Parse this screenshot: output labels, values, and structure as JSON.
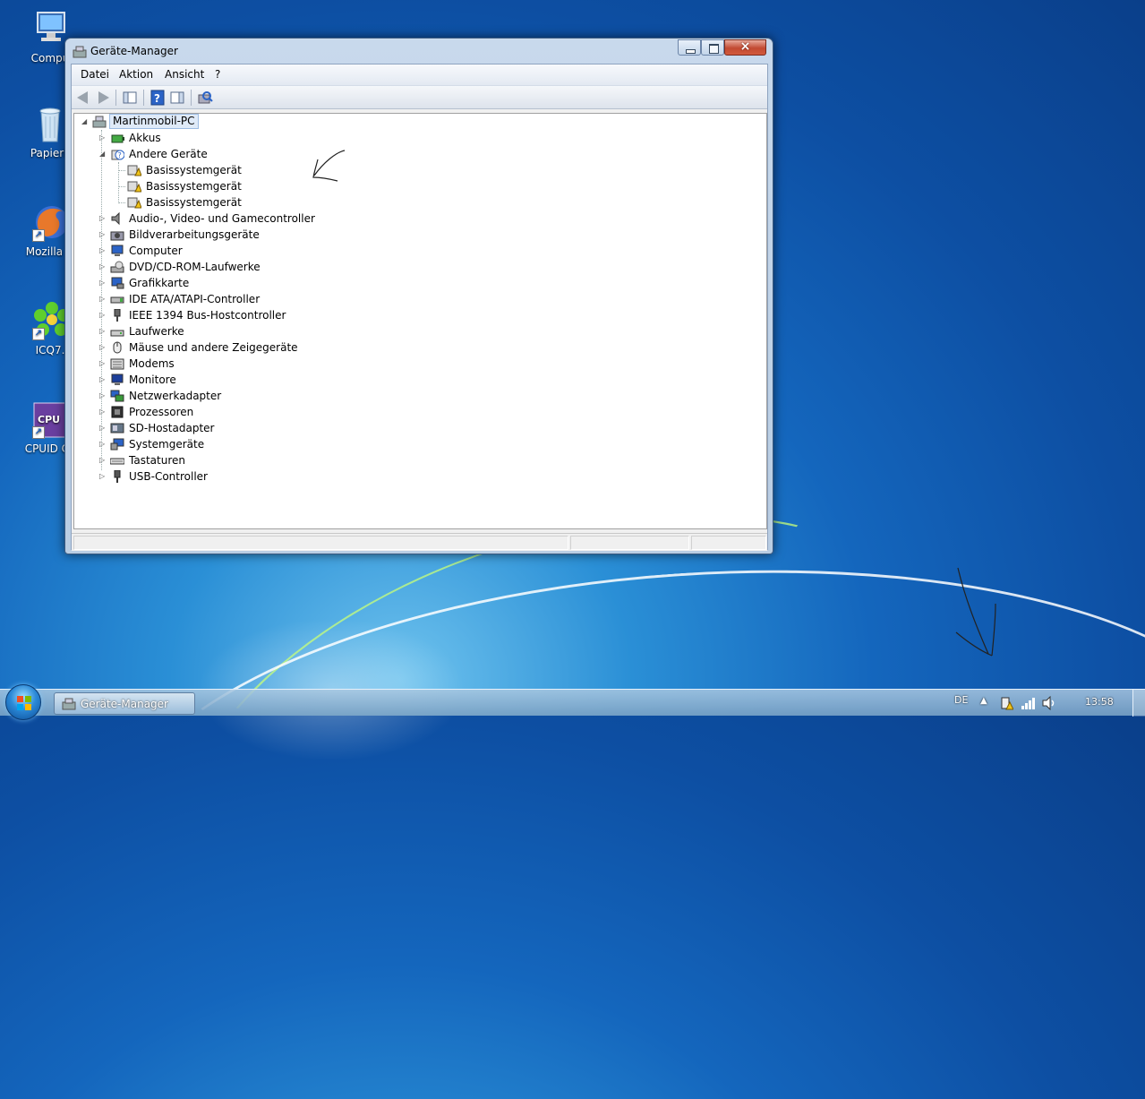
{
  "desktop": {
    "icons": [
      {
        "label": "Compu",
        "name": "computer"
      },
      {
        "label": "Papierk",
        "name": "recycle-bin"
      },
      {
        "label": "Mozilla Fi",
        "name": "firefox"
      },
      {
        "label": "ICQ7.",
        "name": "icq"
      },
      {
        "label": "CPUID CP",
        "name": "cpuid"
      }
    ]
  },
  "window": {
    "title": "Geräte-Manager",
    "close_glyph": "×",
    "menu": [
      "Datei",
      "Aktion",
      "Ansicht",
      "?"
    ],
    "tree": {
      "root": "Martinmobil-PC",
      "items": [
        {
          "label": "Akkus",
          "icon": "battery-icon"
        },
        {
          "label": "Andere Geräte",
          "icon": "unknown-device-icon",
          "expanded": true,
          "children": [
            "Basissystemgerät",
            "Basissystemgerät",
            "Basissystemgerät"
          ]
        },
        {
          "label": "Audio-, Video- und Gamecontroller",
          "icon": "speaker-icon"
        },
        {
          "label": "Bildverarbeitungsgeräte",
          "icon": "camera-icon"
        },
        {
          "label": "Computer",
          "icon": "computer-icon"
        },
        {
          "label": "DVD/CD-ROM-Laufwerke",
          "icon": "disc-drive-icon"
        },
        {
          "label": "Grafikkarte",
          "icon": "display-adapter-icon"
        },
        {
          "label": "IDE ATA/ATAPI-Controller",
          "icon": "ide-controller-icon"
        },
        {
          "label": "IEEE 1394 Bus-Hostcontroller",
          "icon": "firewire-icon"
        },
        {
          "label": "Laufwerke",
          "icon": "disk-drive-icon"
        },
        {
          "label": "Mäuse und andere Zeigegeräte",
          "icon": "mouse-icon"
        },
        {
          "label": "Modems",
          "icon": "modem-icon"
        },
        {
          "label": "Monitore",
          "icon": "monitor-icon"
        },
        {
          "label": "Netzwerkadapter",
          "icon": "network-adapter-icon"
        },
        {
          "label": "Prozessoren",
          "icon": "processor-icon"
        },
        {
          "label": "SD-Hostadapter",
          "icon": "sd-host-icon"
        },
        {
          "label": "Systemgeräte",
          "icon": "system-devices-icon"
        },
        {
          "label": "Tastaturen",
          "icon": "keyboard-icon"
        },
        {
          "label": "USB-Controller",
          "icon": "usb-icon"
        }
      ]
    }
  },
  "taskbar": {
    "task_label": "Geräte-Manager",
    "language": "DE",
    "clock": "13:58"
  },
  "colors": {
    "accent": "#1466bd",
    "selection": "#dfeaf8",
    "warning": "#f0c419"
  }
}
